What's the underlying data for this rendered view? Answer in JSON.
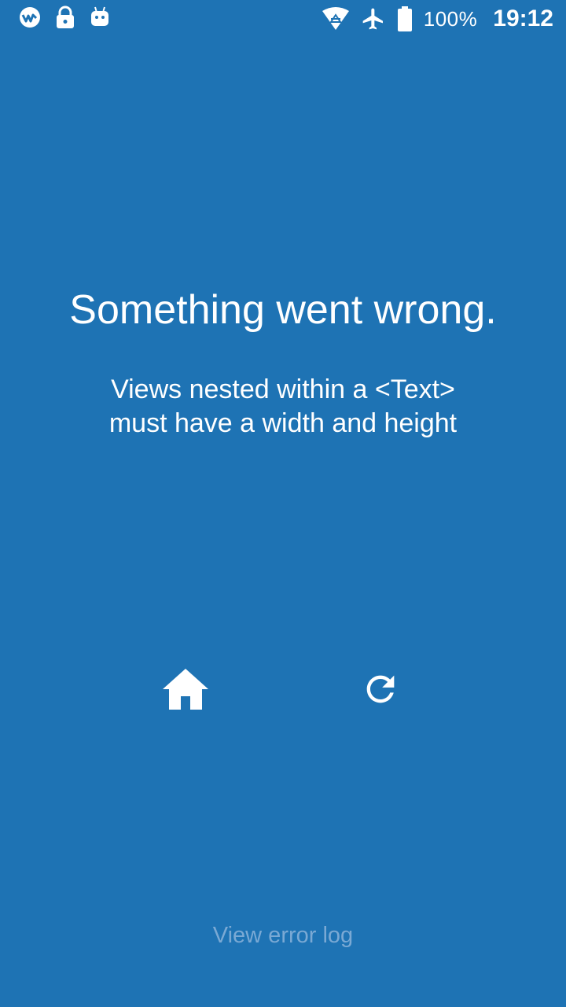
{
  "status_bar": {
    "left_icons": [
      "app-logo-icon",
      "lock-icon",
      "android-icon"
    ],
    "right_icons": [
      "wifi-icon",
      "airplane-mode-icon",
      "battery-icon"
    ],
    "battery_percent": "100%",
    "time": "19:12"
  },
  "error_screen": {
    "title": "Something went wrong.",
    "message_line1": "Views nested within a <Text>",
    "message_line2": "must have a width and height",
    "home_icon": "home-icon",
    "reload_icon": "reload-icon",
    "view_log_label": "View error log"
  },
  "colors": {
    "background": "#1e73b4",
    "text": "#ffffff",
    "link": "#7aa9d4"
  }
}
